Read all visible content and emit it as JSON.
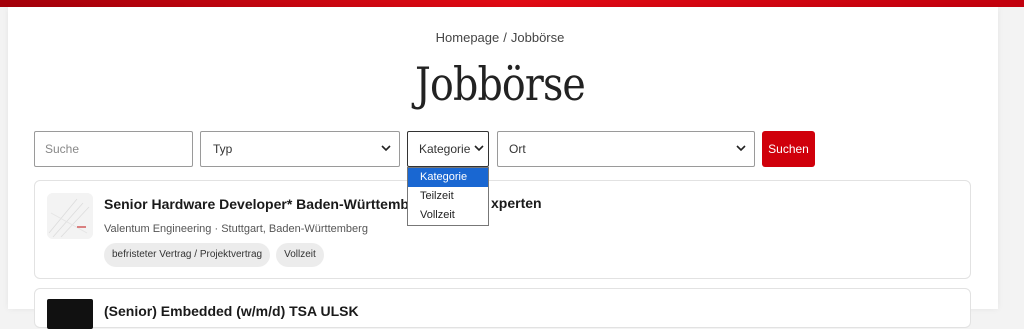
{
  "breadcrumb": {
    "home": "Homepage",
    "separator": "/",
    "current": "Jobbörse"
  },
  "page_title": "Jobbörse",
  "filters": {
    "search_placeholder": "Suche",
    "type_value": "Typ",
    "category_value": "Kategorie",
    "location_value": "Ort",
    "submit_label": "Suchen",
    "category_options": [
      "Kategorie",
      "Teilzeit",
      "Vollzeit"
    ],
    "category_highlighted": "Kategorie"
  },
  "jobs": [
    {
      "title": "Senior Hardware Developer* Baden-Württemberg",
      "title_tail": "xperten",
      "company": "Valentum Engineering",
      "location": "Stuttgart, Baden-Württemberg",
      "meta": "Valentum Engineering · Stuttgart, Baden-Württemberg",
      "tags": [
        "befristeter Vertrag / Projektvertrag",
        "Vollzeit"
      ]
    },
    {
      "title": "(Senior) Embedded (w/m/d) TSA ULSK"
    }
  ],
  "colors": {
    "accent": "#d0000b",
    "top_bar": "#e10a14",
    "dropdown_highlight": "#1967d2"
  },
  "icons": {
    "select_chevron": "chevron-down-icon"
  }
}
